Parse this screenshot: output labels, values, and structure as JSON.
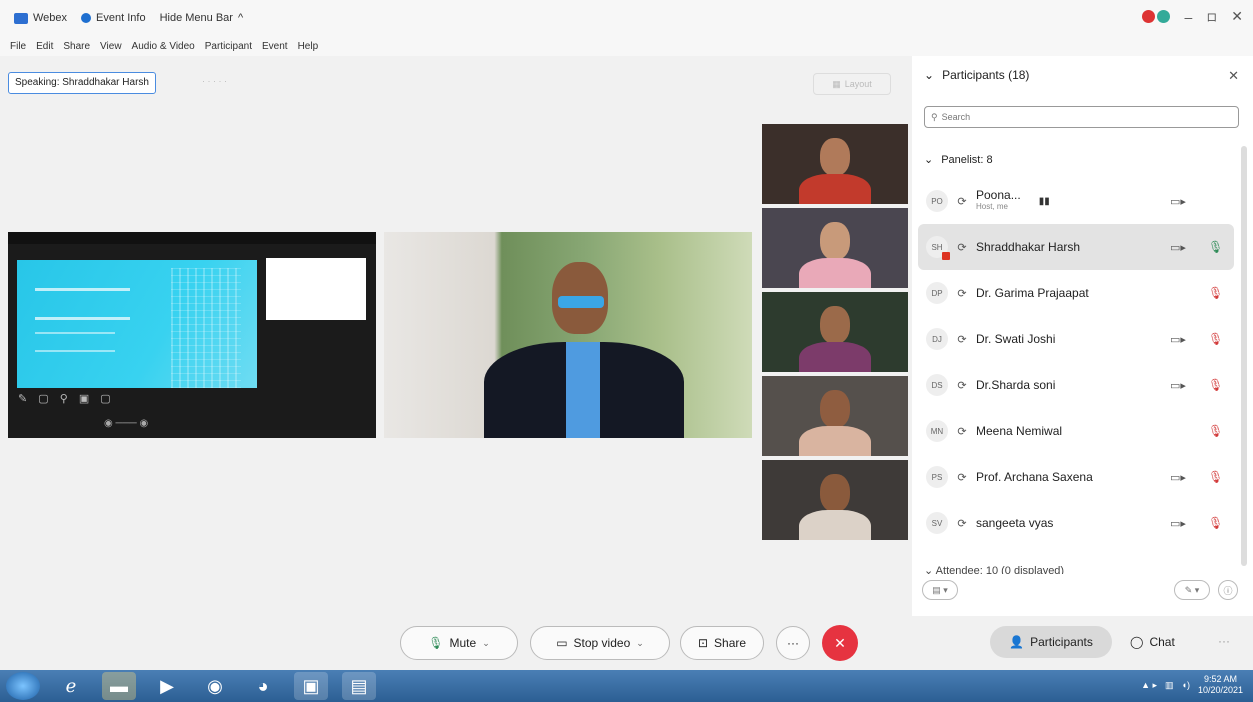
{
  "titlebar": {
    "app": "Webex",
    "event_info": "Event Info",
    "hide_menu": "Hide Menu Bar",
    "hide_menu_chevron": "^",
    "minimize": "–",
    "maximize": "ロ",
    "close": "✕"
  },
  "menubar": [
    "File",
    "Edit",
    "Share",
    "View",
    "Audio & Video",
    "Participant",
    "Event",
    "Help"
  ],
  "stage": {
    "speaking_label": "Speaking: Shraddhakar Harsh",
    "layout_label": "Layout"
  },
  "controls": {
    "mute": "Mute",
    "stop_video": "Stop video",
    "share": "Share",
    "more": "···",
    "end": "✕",
    "participants": "Participants",
    "chat": "Chat",
    "overflow": "···"
  },
  "panel": {
    "title": "Participants (18)",
    "close": "✕",
    "search_placeholder": "Search",
    "panelist_section": "Panelist: 8",
    "attendee_section": "Attendee: 10 (0 displayed)",
    "participants": [
      {
        "initials": "PO",
        "name": "Poona...",
        "sub": "Host, me",
        "video": true,
        "mic": "none",
        "highlight": false
      },
      {
        "initials": "SH",
        "name": "Shraddhakar Harsh",
        "sub": "",
        "video": true,
        "mic": "on",
        "highlight": true
      },
      {
        "initials": "DP",
        "name": "Dr. Garima Prajaapat",
        "sub": "",
        "video": false,
        "mic": "muted",
        "highlight": false
      },
      {
        "initials": "DJ",
        "name": "Dr. Swati Joshi",
        "sub": "",
        "video": true,
        "mic": "muted",
        "highlight": false
      },
      {
        "initials": "DS",
        "name": "Dr.Sharda soni",
        "sub": "",
        "video": true,
        "mic": "muted",
        "highlight": false
      },
      {
        "initials": "MN",
        "name": "Meena Nemiwal",
        "sub": "",
        "video": false,
        "mic": "muted",
        "highlight": false
      },
      {
        "initials": "PS",
        "name": "Prof. Archana Saxena",
        "sub": "",
        "video": true,
        "mic": "muted",
        "highlight": false
      },
      {
        "initials": "SV",
        "name": "sangeeta vyas",
        "sub": "",
        "video": true,
        "mic": "muted",
        "highlight": false
      }
    ]
  },
  "taskbar": {
    "time": "9:52 AM",
    "date": "10/20/2021"
  },
  "colors": {
    "accent": "#2d6fd1",
    "end_call": "#e63340",
    "mic_on": "#2e8b57",
    "mic_muted": "#d23a3a"
  }
}
